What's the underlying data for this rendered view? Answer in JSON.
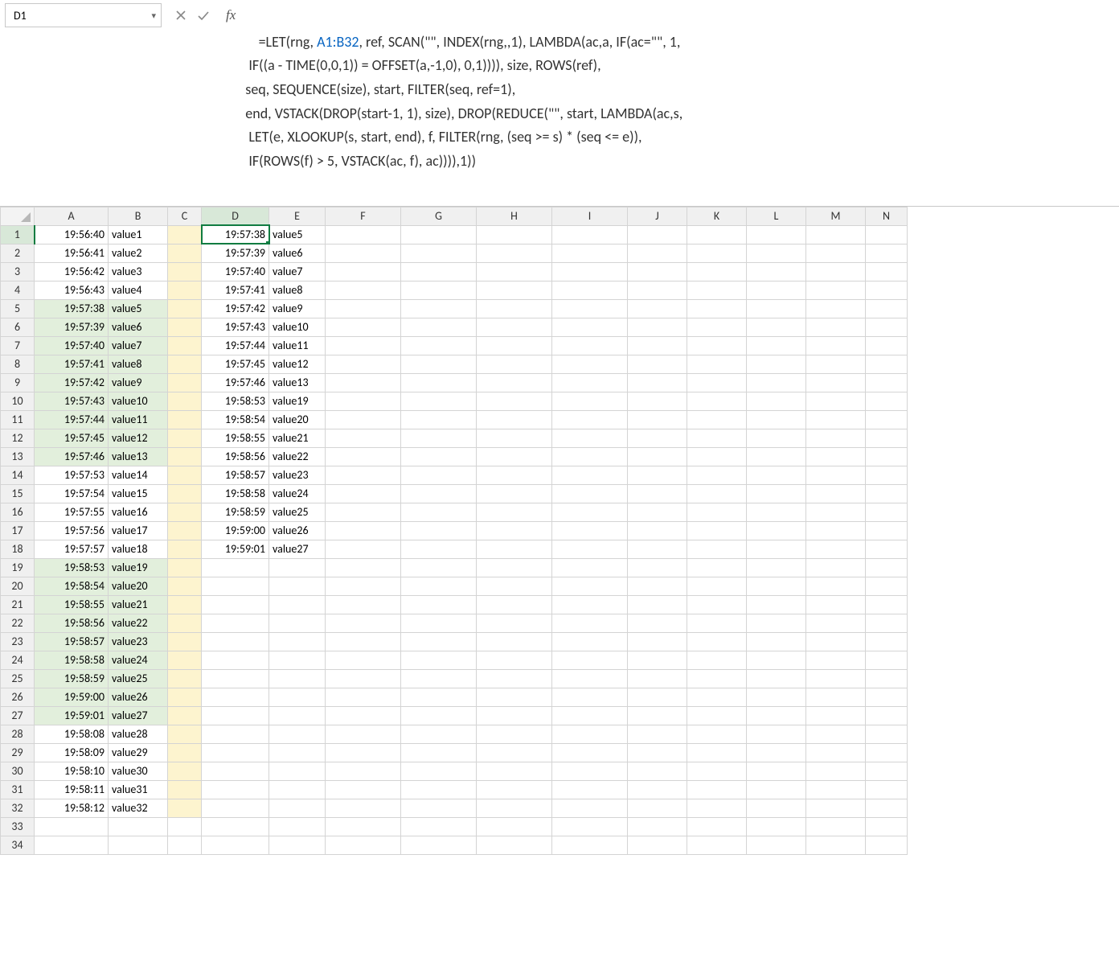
{
  "nameBox": {
    "value": "D1"
  },
  "formulaBar": {
    "prefix": "=LET(rng, ",
    "ref": "A1:B32",
    "rest": ", ref, SCAN(\"\", INDEX(rng,,1), LAMBDA(ac,a, IF(ac=\"\", 1,\n IF((a - TIME(0,0,1)) = OFFSET(a,-1,0), 0,1)))), size, ROWS(ref),\nseq, SEQUENCE(size), start, FILTER(seq, ref=1),\nend, VSTACK(DROP(start-1, 1), size), DROP(REDUCE(\"\", start, LAMBDA(ac,s,\n LET(e, XLOOKUP(s, start, end), f, FILTER(rng, (seq >= s) * (seq <= e)),\n IF(ROWS(f) > 5, VSTACK(ac, f), ac)))),1))"
  },
  "fxLabel": "fx",
  "columns": [
    "A",
    "B",
    "C",
    "D",
    "E",
    "F",
    "G",
    "H",
    "I",
    "J",
    "K",
    "L",
    "M",
    "N"
  ],
  "colWidths": {
    "A": 92,
    "B": 74,
    "C": 42,
    "D": 84,
    "E": 70,
    "F": 94,
    "G": 94,
    "H": 94,
    "I": 94,
    "J": 74,
    "K": 74,
    "L": 74,
    "M": 74,
    "N": 52
  },
  "rowCount": 33,
  "selectedCell": "D1",
  "spill": {
    "startCol": "D",
    "endCol": "E",
    "startRow": 1,
    "endRow": 18
  },
  "highlightGreenRows": [
    5,
    6,
    7,
    8,
    9,
    10,
    11,
    12,
    13,
    19,
    20,
    21,
    22,
    23,
    24,
    25,
    26,
    27
  ],
  "highlightYellowColumn": "C",
  "dataA": [
    "19:56:40",
    "19:56:41",
    "19:56:42",
    "19:56:43",
    "19:57:38",
    "19:57:39",
    "19:57:40",
    "19:57:41",
    "19:57:42",
    "19:57:43",
    "19:57:44",
    "19:57:45",
    "19:57:46",
    "19:57:53",
    "19:57:54",
    "19:57:55",
    "19:57:56",
    "19:57:57",
    "19:58:53",
    "19:58:54",
    "19:58:55",
    "19:58:56",
    "19:58:57",
    "19:58:58",
    "19:58:59",
    "19:59:00",
    "19:59:01",
    "19:58:08",
    "19:58:09",
    "19:58:10",
    "19:58:11",
    "19:58:12"
  ],
  "dataB": [
    "value1",
    "value2",
    "value3",
    "value4",
    "value5",
    "value6",
    "value7",
    "value8",
    "value9",
    "value10",
    "value11",
    "value12",
    "value13",
    "value14",
    "value15",
    "value16",
    "value17",
    "value18",
    "value19",
    "value20",
    "value21",
    "value22",
    "value23",
    "value24",
    "value25",
    "value26",
    "value27",
    "value28",
    "value29",
    "value30",
    "value31",
    "value32"
  ],
  "dataD": [
    "19:57:38",
    "19:57:39",
    "19:57:40",
    "19:57:41",
    "19:57:42",
    "19:57:43",
    "19:57:44",
    "19:57:45",
    "19:57:46",
    "19:58:53",
    "19:58:54",
    "19:58:55",
    "19:58:56",
    "19:58:57",
    "19:58:58",
    "19:58:59",
    "19:59:00",
    "19:59:01"
  ],
  "dataE": [
    "value5",
    "value6",
    "value7",
    "value8",
    "value9",
    "value10",
    "value11",
    "value12",
    "value13",
    "value19",
    "value20",
    "value21",
    "value22",
    "value23",
    "value24",
    "value25",
    "value26",
    "value27"
  ]
}
